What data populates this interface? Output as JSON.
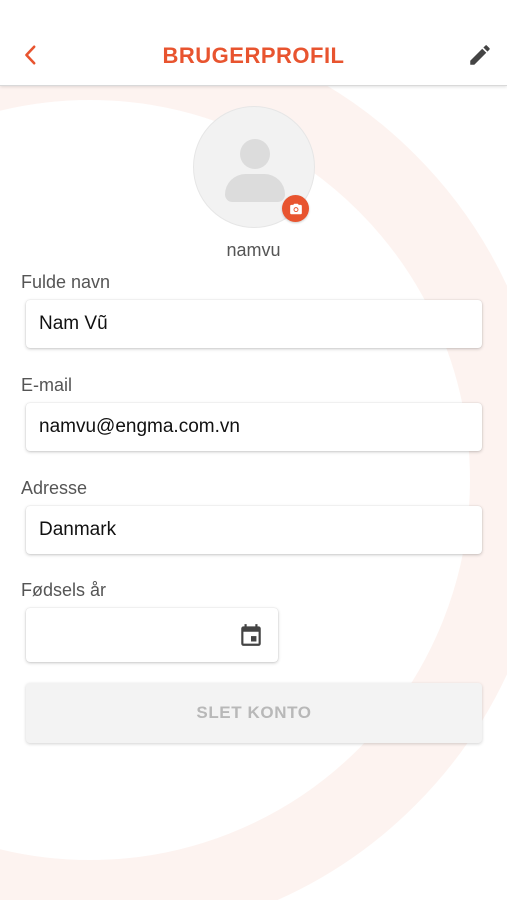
{
  "header": {
    "title": "BRUGERPROFIL",
    "back_icon": "chevron-left-icon",
    "edit_icon": "pencil-icon"
  },
  "profile": {
    "username": "namvu",
    "camera_icon": "camera-icon"
  },
  "form": {
    "full_name": {
      "label": "Fulde navn",
      "value": "Nam Vũ"
    },
    "email": {
      "label": "E-mail",
      "value": "namvu@engma.com.vn"
    },
    "address": {
      "label": "Adresse",
      "value": "Danmark"
    },
    "birth_year": {
      "label": "Fødsels år",
      "value": "",
      "icon": "calendar-icon"
    }
  },
  "actions": {
    "delete_account_label": "SLET KONTO"
  },
  "colors": {
    "accent": "#e8542f",
    "label": "#555555",
    "disabled_text": "#b8b8b8"
  }
}
